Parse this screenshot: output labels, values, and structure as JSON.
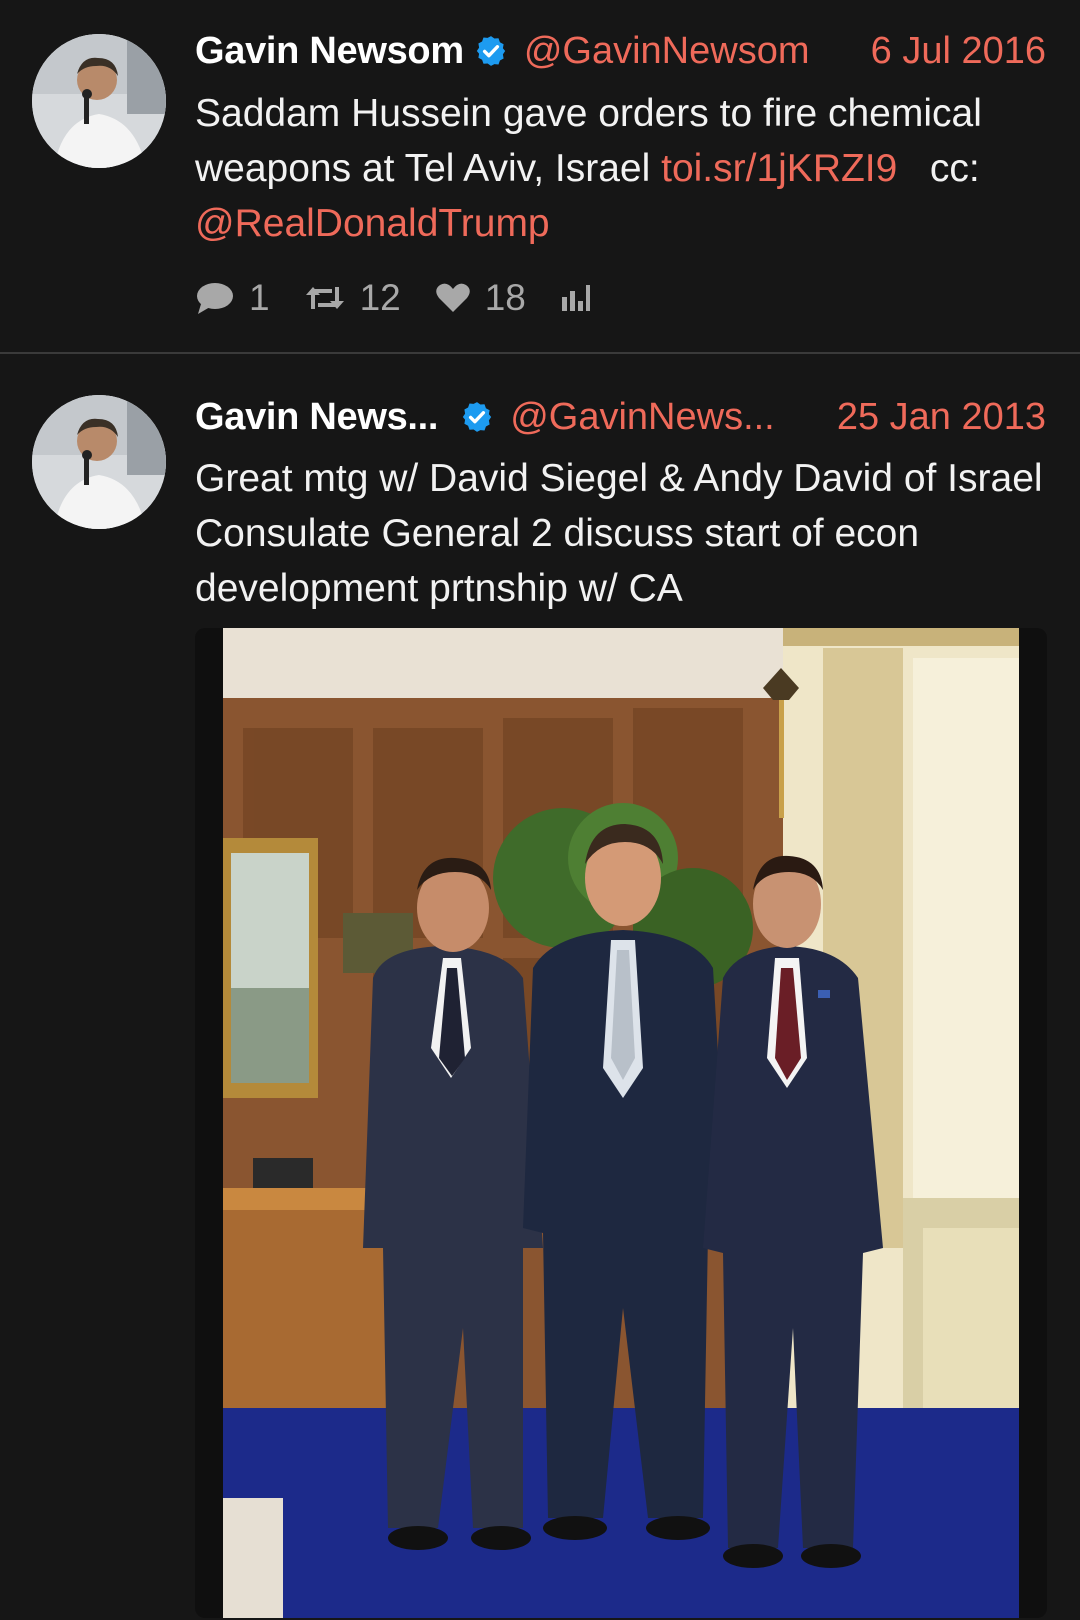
{
  "tweets": [
    {
      "author": {
        "name": "Gavin Newsom",
        "handle": "@GavinNewsom",
        "verified": true
      },
      "date": "6 Jul 2016",
      "text": {
        "part1": "Saddam Hussein gave orders to fire chemical weapons at Tel Aviv, Israel ",
        "link": "toi.sr/1jKRZI9",
        "part2": "   cc: ",
        "mention": "@RealDonaldTrump"
      },
      "stats": {
        "replies": "1",
        "retweets": "12",
        "likes": "18"
      }
    },
    {
      "author": {
        "name": "Gavin News...",
        "handle": "@GavinNews...",
        "verified": true
      },
      "date": "25 Jan 2013",
      "text": "Great mtg w/ David Siegel & Andy David of Israel Consulate General 2 discuss start of econ development prtnship w/ CA",
      "media": {
        "type": "photo",
        "people_count": 3
      }
    }
  ],
  "colors": {
    "background": "#161616",
    "accent": "#ef6a5a",
    "verified": "#1d9bf0",
    "text": "#f2f2f2",
    "muted": "#a8a8a8",
    "divider": "#3a3a3a"
  },
  "icons": [
    "reply-icon",
    "retweet-icon",
    "like-icon",
    "analytics-icon",
    "verified-badge-icon"
  ]
}
